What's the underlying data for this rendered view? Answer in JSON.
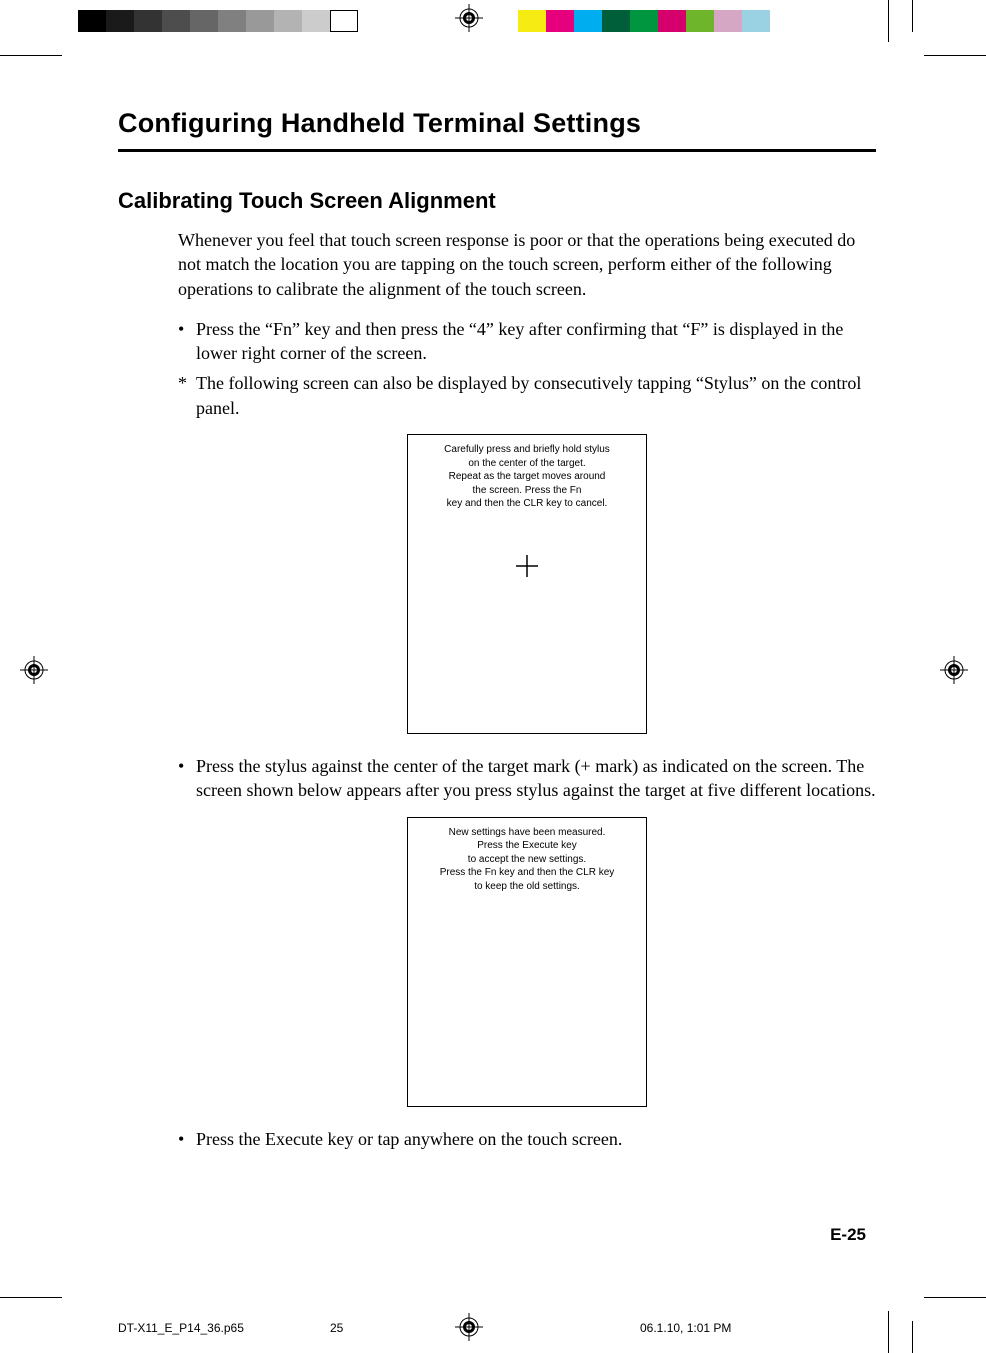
{
  "title": "Configuring Handheld Terminal Settings",
  "subtitle": "Calibrating Touch Screen Alignment",
  "intro": "Whenever you feel that touch screen response is poor or that the operations being executed do not match the location you are tapping on the touch screen, perform either of the following operations to calibrate the alignment of the touch screen.",
  "bullets_top": [
    {
      "marker": "•",
      "text": "Press the “Fn” key and then press the “4” key after confirming that “F” is displayed in the lower right corner of the screen."
    },
    {
      "marker": "*",
      "text": "The following screen can also be displayed by consecutively tapping “Stylus” on the control panel."
    }
  ],
  "screen1_text": "Carefully press and briefly hold stylus\non the center of the target.\nRepeat as the target moves around\nthe screen. Press the Fn\nkey and then the CLR key to cancel.",
  "bullet_middle": {
    "marker": "•",
    "text": "Press the stylus against the center of the target mark (+ mark) as indicated on the screen. The screen shown below appears after you press stylus against the target at five different locations."
  },
  "screen2_text": "New settings have been measured.\nPress the Execute key\nto accept the new settings.\nPress the Fn key and then the CLR key\nto keep the old settings.",
  "bullet_bottom": {
    "marker": "•",
    "text": "Press the Execute key or tap anywhere on the touch screen."
  },
  "page_number": "E-25",
  "slug": {
    "file": "DT-X11_E_P14_36.p65",
    "page": "25",
    "datetime": "06.1.10, 1:01 PM"
  },
  "colorbar_left": [
    "#000000",
    "#1a1a1a",
    "#333333",
    "#4d4d4d",
    "#666666",
    "#808080",
    "#999999",
    "#b3b3b3",
    "#cccccc",
    "#ffffff"
  ],
  "colorbar_right": [
    "#f6ec13",
    "#e6007e",
    "#00adef",
    "#005f3b",
    "#009640",
    "#d6006c",
    "#6fb52c",
    "#d6a7c5",
    "#9ad2e4"
  ]
}
